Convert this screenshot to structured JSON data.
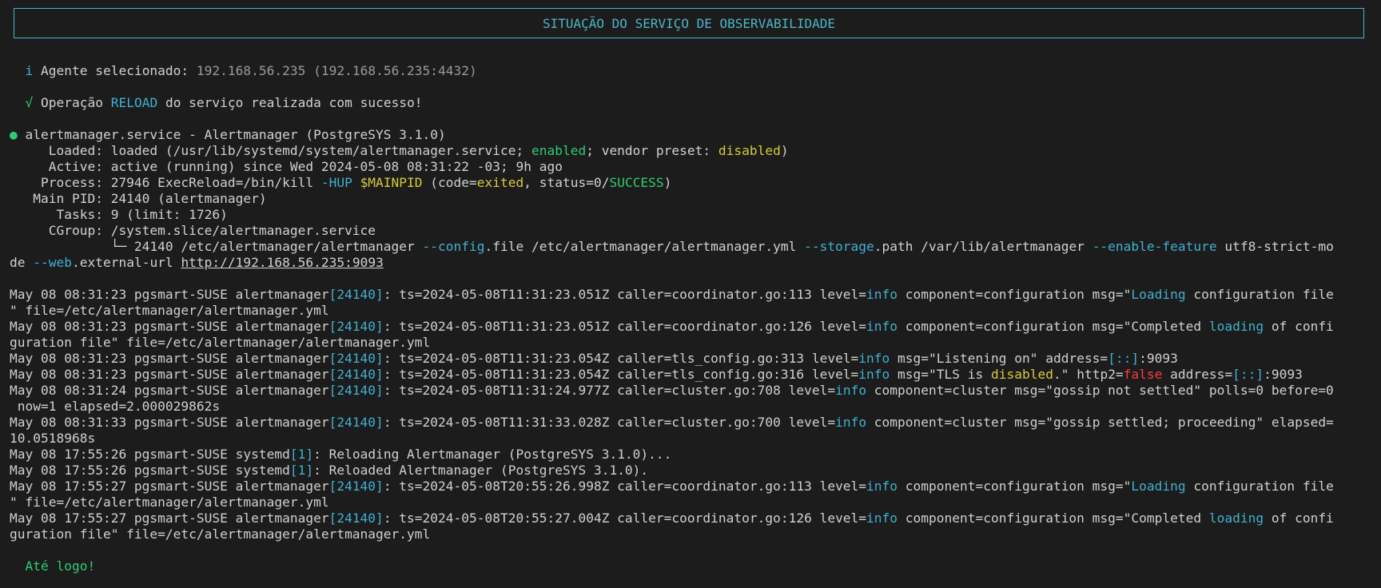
{
  "banner": "SITUAÇÃO DO SERVIÇO DE OBSERVABILIDADE",
  "colors": {
    "cyan": "#3fb0d0",
    "green": "#2ecc71",
    "yellow": "#d8c93a",
    "red": "#ff3b3b",
    "grey": "#9a9a9a",
    "text": "#d0d0d0",
    "background": "#1c1c1c"
  },
  "lines": [
    [
      [
        "  ",
        ""
      ],
      [
        "i",
        "cyan"
      ],
      [
        " Agente selecionado: ",
        ""
      ],
      [
        "192.168.56.235 (192.168.56.235:4432)",
        "grey"
      ]
    ],
    [],
    [
      [
        "  ",
        ""
      ],
      [
        "√",
        "green"
      ],
      [
        " Operação ",
        ""
      ],
      [
        "RELOAD",
        "cyan"
      ],
      [
        " do serviço realizada com sucesso!",
        ""
      ]
    ],
    [],
    [
      [
        "●",
        "green"
      ],
      [
        " alertmanager.service - Alertmanager (PostgreSYS 3.1.0)",
        ""
      ]
    ],
    [
      [
        "     Loaded: loaded (/usr/lib/systemd/system/alertmanager.service; ",
        ""
      ],
      [
        "enabled",
        "green"
      ],
      [
        "; vendor preset: ",
        ""
      ],
      [
        "disabled",
        "yellow"
      ],
      [
        ")",
        ""
      ]
    ],
    [
      [
        "     Active: active (running) since Wed 2024-05-08 08:31:22 -03; 9h ago",
        ""
      ]
    ],
    [
      [
        "    Process: 27946 ExecReload=/bin/kill ",
        ""
      ],
      [
        "-HUP",
        "cyan"
      ],
      [
        " ",
        ""
      ],
      [
        "$MAINPID",
        "yellow"
      ],
      [
        " (code=",
        ""
      ],
      [
        "exited",
        "yellow"
      ],
      [
        ", status=0/",
        ""
      ],
      [
        "SUCCESS",
        "green"
      ],
      [
        ")",
        ""
      ]
    ],
    [
      [
        "   Main PID: 24140 (alertmanager)",
        ""
      ]
    ],
    [
      [
        "      Tasks: 9 (limit: 1726)",
        ""
      ]
    ],
    [
      [
        "     CGroup: /system.slice/alertmanager.service",
        ""
      ]
    ],
    [
      [
        "             └─ 24140 /etc/alertmanager/alertmanager ",
        ""
      ],
      [
        "--config",
        "cyan"
      ],
      [
        ".file /etc/alertmanager/alertmanager.yml ",
        ""
      ],
      [
        "--storage",
        "cyan"
      ],
      [
        ".path /var/lib/alertmanager ",
        ""
      ],
      [
        "--enable-feature",
        "cyan"
      ],
      [
        " utf8-strict-mo",
        ""
      ]
    ],
    [
      [
        "de ",
        ""
      ],
      [
        "--web",
        "cyan"
      ],
      [
        ".external-url ",
        ""
      ],
      [
        "http://192.168.56.235:9093",
        "u"
      ]
    ],
    [],
    [
      [
        "May 08 08:31:23 pgsmart-SUSE alertmanager",
        ""
      ],
      [
        "[24140]",
        "cyan"
      ],
      [
        ": ts=2024-05-08T11:31:23.051Z caller=coordinator.go:113 level=",
        ""
      ],
      [
        "info",
        "cyan"
      ],
      [
        " component=configuration msg=\"",
        ""
      ],
      [
        "Loading",
        "cyan"
      ],
      [
        " configuration file",
        ""
      ]
    ],
    [
      [
        "\" file=/etc/alertmanager/alertmanager.yml",
        ""
      ]
    ],
    [
      [
        "May 08 08:31:23 pgsmart-SUSE alertmanager",
        ""
      ],
      [
        "[24140]",
        "cyan"
      ],
      [
        ": ts=2024-05-08T11:31:23.051Z caller=coordinator.go:126 level=",
        ""
      ],
      [
        "info",
        "cyan"
      ],
      [
        " component=configuration msg=\"Completed ",
        ""
      ],
      [
        "loading",
        "cyan"
      ],
      [
        " of confi",
        ""
      ]
    ],
    [
      [
        "guration file\" file=/etc/alertmanager/alertmanager.yml",
        ""
      ]
    ],
    [
      [
        "May 08 08:31:23 pgsmart-SUSE alertmanager",
        ""
      ],
      [
        "[24140]",
        "cyan"
      ],
      [
        ": ts=2024-05-08T11:31:23.054Z caller=tls_config.go:313 level=",
        ""
      ],
      [
        "info",
        "cyan"
      ],
      [
        " msg=\"Listening on\" address=",
        ""
      ],
      [
        "[::]",
        "cyan"
      ],
      [
        ":9093",
        ""
      ]
    ],
    [
      [
        "May 08 08:31:23 pgsmart-SUSE alertmanager",
        ""
      ],
      [
        "[24140]",
        "cyan"
      ],
      [
        ": ts=2024-05-08T11:31:23.054Z caller=tls_config.go:316 level=",
        ""
      ],
      [
        "info",
        "cyan"
      ],
      [
        " msg=\"TLS is ",
        ""
      ],
      [
        "disabled",
        "yellow"
      ],
      [
        ".\" http2=",
        ""
      ],
      [
        "false",
        "red"
      ],
      [
        " address=",
        ""
      ],
      [
        "[::]",
        "cyan"
      ],
      [
        ":9093",
        ""
      ]
    ],
    [
      [
        "May 08 08:31:24 pgsmart-SUSE alertmanager",
        ""
      ],
      [
        "[24140]",
        "cyan"
      ],
      [
        ": ts=2024-05-08T11:31:24.977Z caller=cluster.go:708 level=",
        ""
      ],
      [
        "info",
        "cyan"
      ],
      [
        " component=cluster msg=\"gossip not settled\" polls=0 before=0",
        ""
      ]
    ],
    [
      [
        " now=1 elapsed=2.000029862s",
        ""
      ]
    ],
    [
      [
        "May 08 08:31:33 pgsmart-SUSE alertmanager",
        ""
      ],
      [
        "[24140]",
        "cyan"
      ],
      [
        ": ts=2024-05-08T11:31:33.028Z caller=cluster.go:700 level=",
        ""
      ],
      [
        "info",
        "cyan"
      ],
      [
        " component=cluster msg=\"gossip settled; proceeding\" elapsed=",
        ""
      ]
    ],
    [
      [
        "10.0518968s",
        ""
      ]
    ],
    [
      [
        "May 08 17:55:26 pgsmart-SUSE systemd",
        ""
      ],
      [
        "[1]",
        "cyan"
      ],
      [
        ": Reloading Alertmanager (PostgreSYS 3.1.0)...",
        ""
      ]
    ],
    [
      [
        "May 08 17:55:26 pgsmart-SUSE systemd",
        ""
      ],
      [
        "[1]",
        "cyan"
      ],
      [
        ": Reloaded Alertmanager (PostgreSYS 3.1.0).",
        ""
      ]
    ],
    [
      [
        "May 08 17:55:27 pgsmart-SUSE alertmanager",
        ""
      ],
      [
        "[24140]",
        "cyan"
      ],
      [
        ": ts=2024-05-08T20:55:26.998Z caller=coordinator.go:113 level=",
        ""
      ],
      [
        "info",
        "cyan"
      ],
      [
        " component=configuration msg=\"",
        ""
      ],
      [
        "Loading",
        "cyan"
      ],
      [
        " configuration file",
        ""
      ]
    ],
    [
      [
        "\" file=/etc/alertmanager/alertmanager.yml",
        ""
      ]
    ],
    [
      [
        "May 08 17:55:27 pgsmart-SUSE alertmanager",
        ""
      ],
      [
        "[24140]",
        "cyan"
      ],
      [
        ": ts=2024-05-08T20:55:27.004Z caller=coordinator.go:126 level=",
        ""
      ],
      [
        "info",
        "cyan"
      ],
      [
        " component=configuration msg=\"Completed ",
        ""
      ],
      [
        "loading",
        "cyan"
      ],
      [
        " of confi",
        ""
      ]
    ],
    [
      [
        "guration file\" file=/etc/alertmanager/alertmanager.yml",
        ""
      ]
    ],
    [],
    [
      [
        "  ",
        ""
      ],
      [
        "Até logo!",
        "green"
      ]
    ]
  ]
}
